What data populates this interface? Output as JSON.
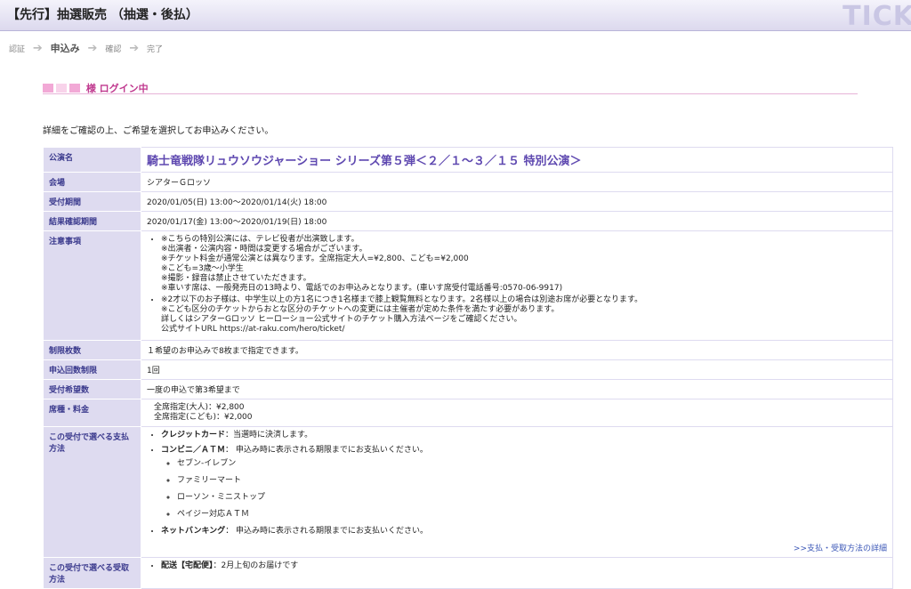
{
  "header": {
    "title": "【先行】抽選販売 （抽選・後払）",
    "brand": "TICK"
  },
  "steps": {
    "s1": "認証",
    "s2": "申込み",
    "s3": "確認",
    "s4": "完了"
  },
  "login": {
    "suffix": "様 ログイン中"
  },
  "intro": "詳細をご確認の上、ご希望を選択してお申込みください。",
  "rows": {
    "event": {
      "label": "公演名",
      "value": "騎士竜戦隊リュウソウジャーショー シリーズ第５弾＜２／１～３／１５ 特別公演＞"
    },
    "venue": {
      "label": "会場",
      "value": "シアターＧロッソ"
    },
    "period": {
      "label": "受付期間",
      "value": "2020/01/05(日) 13:00～2020/01/14(火) 18:00"
    },
    "result": {
      "label": "結果確認期間",
      "value": "2020/01/17(金) 13:00～2020/01/19(日) 18:00"
    },
    "notes": {
      "label": "注意事項",
      "item1": [
        "※こちらの特別公演には、テレビ役者が出演致します。",
        "※出演者・公演内容・時間は変更する場合がございます。",
        "※チケット料金が通常公演とは異なります。全席指定大人=¥2,800、こども=¥2,000",
        "※こども=3歳～小学生",
        "※撮影・録音は禁止させていただきます。",
        "※車いす席は、一般発売日の13時より、電話でのお申込みとなります。(車いす席受付電話番号:0570-06-9917)"
      ],
      "item2": [
        "※2才以下のお子様は、中学生以上の方1名につき1名様まで膝上観覧無料となります。2名様以上の場合は別途お席が必要となります。",
        "※こども区分のチケットからおとな区分のチケットへの変更には主催者が定めた条件を満たす必要があります。",
        "詳しくはシアターGロッソ ヒーローショー公式サイトのチケット購入方法ページをご確認ください。",
        "公式サイトURL https://at-raku.com/hero/ticket/"
      ]
    },
    "limit": {
      "label": "制限枚数",
      "value": "１希望のお申込みで8枚まで指定できます。"
    },
    "count": {
      "label": "申込回数制限",
      "value": "1回"
    },
    "wish": {
      "label": "受付希望数",
      "value": "一度の申込で第3希望まで"
    },
    "price": {
      "label": "席種・料金",
      "adult": "全席指定(大人)：¥2,800",
      "child": "全席指定(こども)：¥2,000"
    },
    "payment": {
      "label": "この受付で選べる支払方法",
      "card_name": "クレジットカード",
      "card_desc": "：当選時に決済します。",
      "conv_name": "コンビニ／ＡＴＭ",
      "conv_desc": "： 申込み時に表示される期限までにお支払いください。",
      "stores": [
        "セブン-イレブン",
        "ファミリーマート",
        "ローソン・ミニストップ",
        "ペイジー対応ＡＴＭ"
      ],
      "net_name": "ネットバンキング",
      "net_desc": "： 申込み時に表示される期限までにお支払いください。",
      "more": ">>支払・受取方法の詳細"
    },
    "receive": {
      "label": "この受付で選べる受取方法",
      "name": "配送【宅配便】",
      "desc": "：2月上旬のお届けです"
    }
  }
}
